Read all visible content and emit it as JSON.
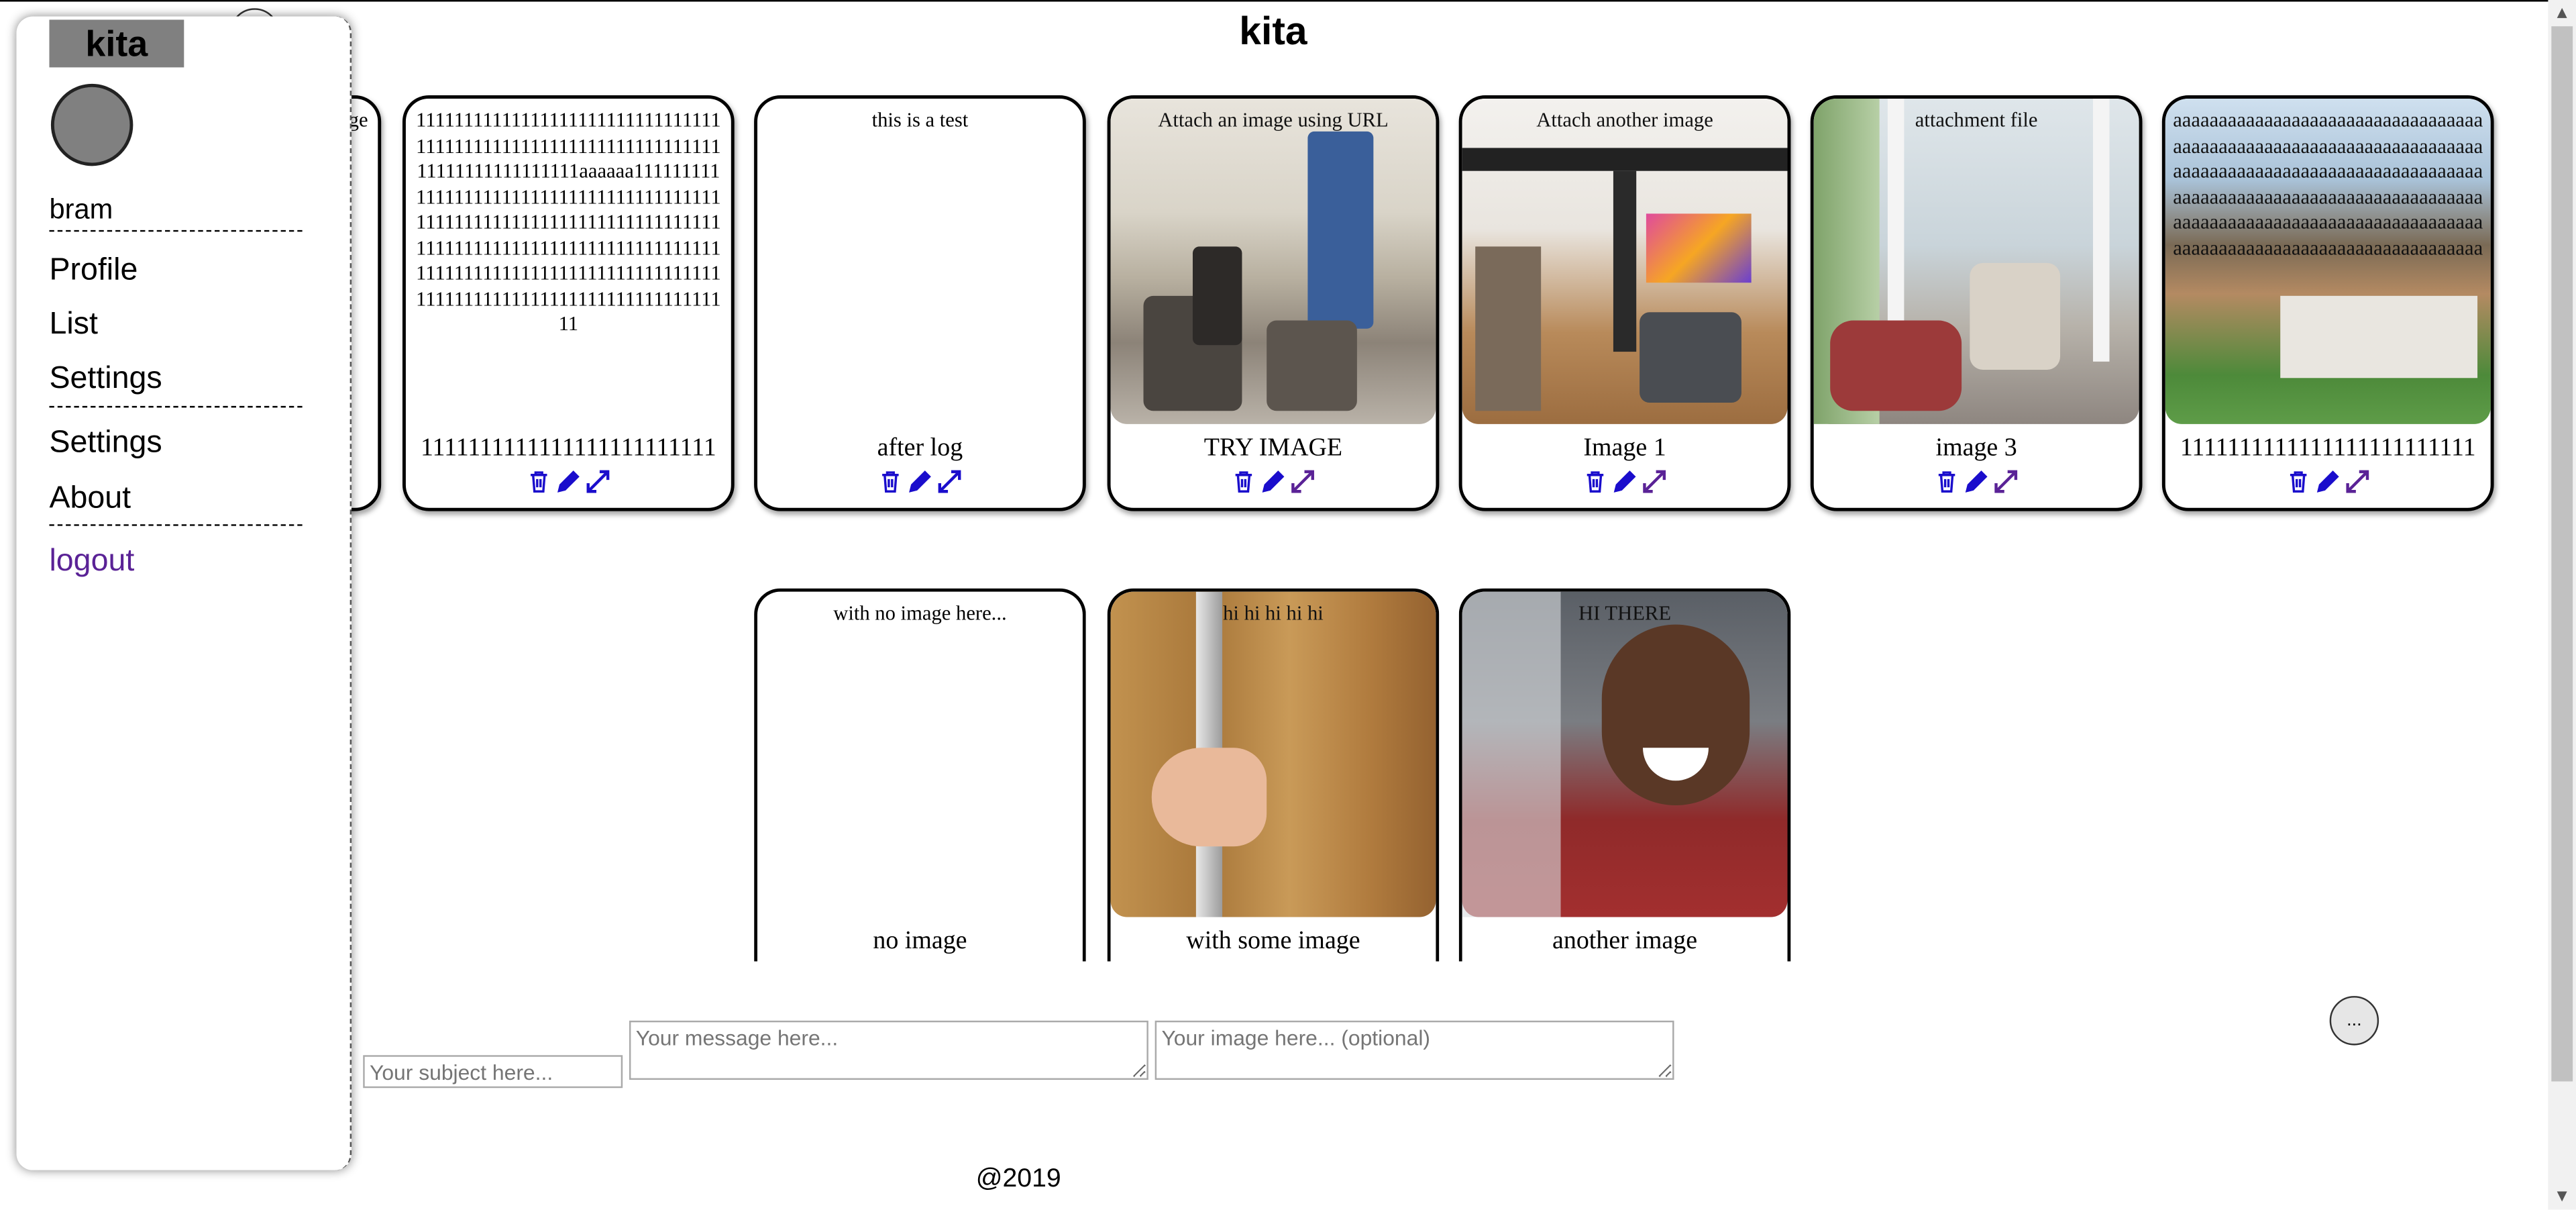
{
  "header": {
    "title": "kita"
  },
  "sidebar": {
    "brand": "kita",
    "username": "bram",
    "items": [
      {
        "label": "Profile"
      },
      {
        "label": "List"
      },
      {
        "label": "Settings"
      },
      {
        "label": "Settings"
      },
      {
        "label": "About"
      }
    ],
    "logout": "logout",
    "logout_color": "#5a2296"
  },
  "cards": [
    {
      "message": "ge",
      "subject": ""
    },
    {
      "message": "111111111111111111111111111111111111111111111111111111111111111111111111111111111aaaaaa111111111111111111111111111111111111111111111111111111111111111111111111111111111111111111111111111111111111111111111111111111111111111111111111111111111111111111111111111",
      "subject": "1111111111111111111111111"
    },
    {
      "message": "this is a test",
      "subject": "after log"
    },
    {
      "message": "Attach an image using URL",
      "subject": "TRY IMAGE"
    },
    {
      "message": "Attach another image",
      "subject": "Image 1"
    },
    {
      "message": "attachment file",
      "subject": "image 3"
    },
    {
      "message": "aaaaaaaaaaaaaaaaaaaaaaaaaaaaaaaaaaaaaaaaaaaaaaaaaaaaaaaaaaaaaaaaaaaaaaaaaaaaaaaaaaaaaaaaaaaaaaaaaaaaaaaaaaaaaaaaaaaaaaaaaaaaaaaaaaaaaaaaaaaaaaaaaaaaaaaaaaaaaaaaaaaaaaaaaaaaaaaaaaaaaaaaaaaaaaaaaaaaaaaaaaaa",
      "subject": "1111111111111111111111111"
    },
    {
      "message": "with no image here...",
      "subject": "no image"
    },
    {
      "message": "hi hi hi hi hi",
      "subject": "with some image"
    },
    {
      "message": "HI THERE",
      "subject": "another image"
    }
  ],
  "action_icons": [
    "trash-icon",
    "pencil-icon",
    "expand-icon"
  ],
  "icon_color": "#1a0dcc",
  "composer": {
    "subject_placeholder": "Your subject here...",
    "message_placeholder": "Your message here...",
    "image_placeholder": "Your image here... (optional)",
    "more_label": "..."
  },
  "footer": {
    "text": "@2019"
  }
}
